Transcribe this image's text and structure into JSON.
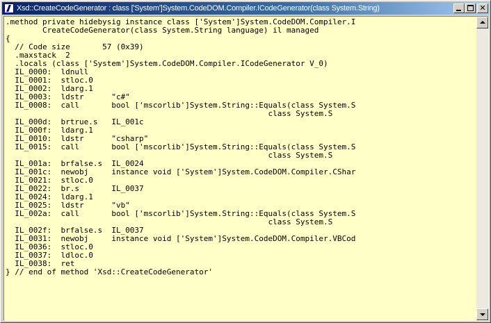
{
  "window": {
    "title": "Xsd::CreateCodeGenerator : class ['System']System.CodeDOM.Compiler.ICodeGenerator(class System.String)",
    "app_icon": "ildasm-icon"
  },
  "titlebar_buttons": {
    "minimize_icon": "minimize-icon",
    "maximize_icon": "maximize-icon",
    "close_icon": "close-icon"
  },
  "code": {
    "lines": [
      ".method private hidebysig instance class ['System']System.CodeDOM.Compiler.I",
      "        CreateCodeGenerator(class System.String language) il managed",
      "{",
      "  // Code size       57 (0x39)",
      "  .maxstack  2",
      "  .locals (class ['System']System.CodeDOM.Compiler.ICodeGenerator V_0)",
      "  IL_0000:  ldnull",
      "  IL_0001:  stloc.0",
      "  IL_0002:  ldarg.1",
      "  IL_0003:  ldstr      \"c#\"",
      "  IL_0008:  call       bool ['mscorlib']System.String::Equals(class System.S",
      "                                                         class System.S",
      "  IL_000d:  brtrue.s   IL_001c",
      "  IL_000f:  ldarg.1",
      "  IL_0010:  ldstr      \"csharp\"",
      "  IL_0015:  call       bool ['mscorlib']System.String::Equals(class System.S",
      "                                                         class System.S",
      "  IL_001a:  brfalse.s  IL_0024",
      "  IL_001c:  newobj     instance void ['System']System.CodeDOM.Compiler.CShar",
      "  IL_0021:  stloc.0",
      "  IL_0022:  br.s       IL_0037",
      "  IL_0024:  ldarg.1",
      "  IL_0025:  ldstr      \"vb\"",
      "  IL_002a:  call       bool ['mscorlib']System.String::Equals(class System.S",
      "                                                         class System.S",
      "  IL_002f:  brfalse.s  IL_0037",
      "  IL_0031:  newobj     instance void ['System']System.CodeDOM.Compiler.VBCod",
      "  IL_0036:  stloc.0",
      "  IL_0037:  ldloc.0",
      "  IL_0038:  ret",
      "} // end of method 'Xsd::CreateCodeGenerator'"
    ]
  },
  "colors": {
    "titlebar_start": "#0a246a",
    "titlebar_end": "#a6caf0",
    "code_background": "#ffffc8",
    "chrome": "#d4d0c8"
  },
  "scrollbar": {
    "up_icon": "scroll-up-arrow-icon",
    "down_icon": "scroll-down-arrow-icon"
  }
}
